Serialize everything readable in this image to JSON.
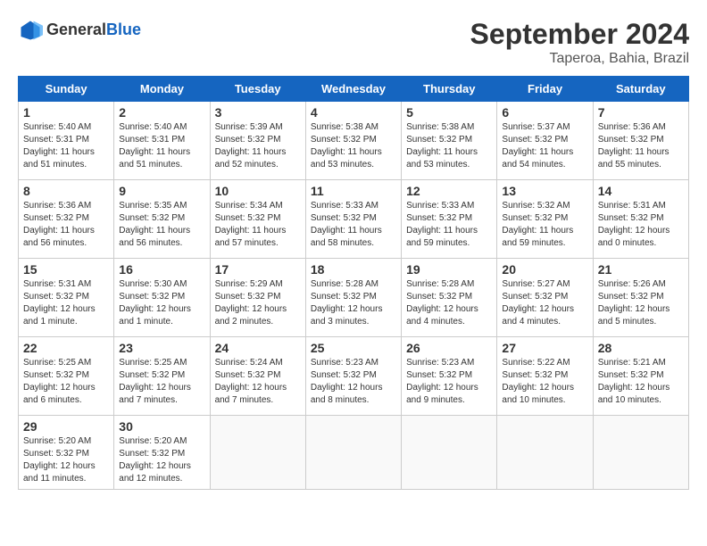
{
  "header": {
    "logo_general": "General",
    "logo_blue": "Blue",
    "month_title": "September 2024",
    "location": "Taperoa, Bahia, Brazil"
  },
  "days_of_week": [
    "Sunday",
    "Monday",
    "Tuesday",
    "Wednesday",
    "Thursday",
    "Friday",
    "Saturday"
  ],
  "weeks": [
    [
      {
        "day": 1,
        "info": "Sunrise: 5:40 AM\nSunset: 5:31 PM\nDaylight: 11 hours\nand 51 minutes."
      },
      {
        "day": 2,
        "info": "Sunrise: 5:40 AM\nSunset: 5:31 PM\nDaylight: 11 hours\nand 51 minutes."
      },
      {
        "day": 3,
        "info": "Sunrise: 5:39 AM\nSunset: 5:32 PM\nDaylight: 11 hours\nand 52 minutes."
      },
      {
        "day": 4,
        "info": "Sunrise: 5:38 AM\nSunset: 5:32 PM\nDaylight: 11 hours\nand 53 minutes."
      },
      {
        "day": 5,
        "info": "Sunrise: 5:38 AM\nSunset: 5:32 PM\nDaylight: 11 hours\nand 53 minutes."
      },
      {
        "day": 6,
        "info": "Sunrise: 5:37 AM\nSunset: 5:32 PM\nDaylight: 11 hours\nand 54 minutes."
      },
      {
        "day": 7,
        "info": "Sunrise: 5:36 AM\nSunset: 5:32 PM\nDaylight: 11 hours\nand 55 minutes."
      }
    ],
    [
      {
        "day": 8,
        "info": "Sunrise: 5:36 AM\nSunset: 5:32 PM\nDaylight: 11 hours\nand 56 minutes."
      },
      {
        "day": 9,
        "info": "Sunrise: 5:35 AM\nSunset: 5:32 PM\nDaylight: 11 hours\nand 56 minutes."
      },
      {
        "day": 10,
        "info": "Sunrise: 5:34 AM\nSunset: 5:32 PM\nDaylight: 11 hours\nand 57 minutes."
      },
      {
        "day": 11,
        "info": "Sunrise: 5:33 AM\nSunset: 5:32 PM\nDaylight: 11 hours\nand 58 minutes."
      },
      {
        "day": 12,
        "info": "Sunrise: 5:33 AM\nSunset: 5:32 PM\nDaylight: 11 hours\nand 59 minutes."
      },
      {
        "day": 13,
        "info": "Sunrise: 5:32 AM\nSunset: 5:32 PM\nDaylight: 11 hours\nand 59 minutes."
      },
      {
        "day": 14,
        "info": "Sunrise: 5:31 AM\nSunset: 5:32 PM\nDaylight: 12 hours\nand 0 minutes."
      }
    ],
    [
      {
        "day": 15,
        "info": "Sunrise: 5:31 AM\nSunset: 5:32 PM\nDaylight: 12 hours\nand 1 minute."
      },
      {
        "day": 16,
        "info": "Sunrise: 5:30 AM\nSunset: 5:32 PM\nDaylight: 12 hours\nand 1 minute."
      },
      {
        "day": 17,
        "info": "Sunrise: 5:29 AM\nSunset: 5:32 PM\nDaylight: 12 hours\nand 2 minutes."
      },
      {
        "day": 18,
        "info": "Sunrise: 5:28 AM\nSunset: 5:32 PM\nDaylight: 12 hours\nand 3 minutes."
      },
      {
        "day": 19,
        "info": "Sunrise: 5:28 AM\nSunset: 5:32 PM\nDaylight: 12 hours\nand 4 minutes."
      },
      {
        "day": 20,
        "info": "Sunrise: 5:27 AM\nSunset: 5:32 PM\nDaylight: 12 hours\nand 4 minutes."
      },
      {
        "day": 21,
        "info": "Sunrise: 5:26 AM\nSunset: 5:32 PM\nDaylight: 12 hours\nand 5 minutes."
      }
    ],
    [
      {
        "day": 22,
        "info": "Sunrise: 5:25 AM\nSunset: 5:32 PM\nDaylight: 12 hours\nand 6 minutes."
      },
      {
        "day": 23,
        "info": "Sunrise: 5:25 AM\nSunset: 5:32 PM\nDaylight: 12 hours\nand 7 minutes."
      },
      {
        "day": 24,
        "info": "Sunrise: 5:24 AM\nSunset: 5:32 PM\nDaylight: 12 hours\nand 7 minutes."
      },
      {
        "day": 25,
        "info": "Sunrise: 5:23 AM\nSunset: 5:32 PM\nDaylight: 12 hours\nand 8 minutes."
      },
      {
        "day": 26,
        "info": "Sunrise: 5:23 AM\nSunset: 5:32 PM\nDaylight: 12 hours\nand 9 minutes."
      },
      {
        "day": 27,
        "info": "Sunrise: 5:22 AM\nSunset: 5:32 PM\nDaylight: 12 hours\nand 10 minutes."
      },
      {
        "day": 28,
        "info": "Sunrise: 5:21 AM\nSunset: 5:32 PM\nDaylight: 12 hours\nand 10 minutes."
      }
    ],
    [
      {
        "day": 29,
        "info": "Sunrise: 5:20 AM\nSunset: 5:32 PM\nDaylight: 12 hours\nand 11 minutes."
      },
      {
        "day": 30,
        "info": "Sunrise: 5:20 AM\nSunset: 5:32 PM\nDaylight: 12 hours\nand 12 minutes."
      },
      null,
      null,
      null,
      null,
      null
    ]
  ]
}
